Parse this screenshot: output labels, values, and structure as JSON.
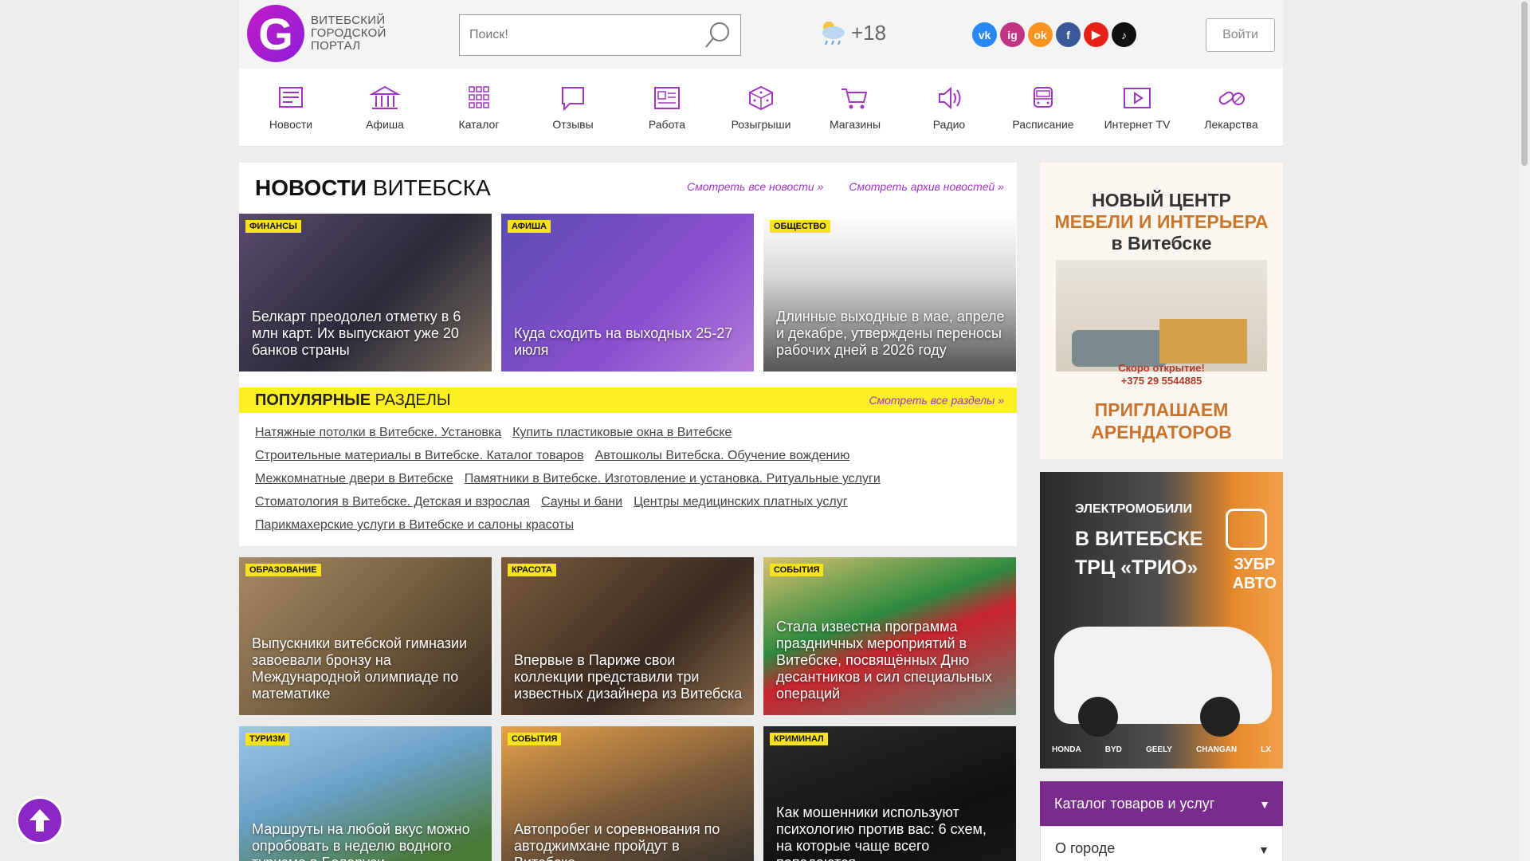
{
  "header": {
    "logo_letter": "G",
    "logo_lines": [
      "ВИТЕБСКИЙ",
      "ГОРОДСКОЙ",
      "ПОРТАЛ"
    ],
    "search_placeholder": "Поиск!",
    "weather_temp": "+18",
    "login_label": "Войти",
    "socials": [
      {
        "name": "vk-icon",
        "label": "vk",
        "color": "#2787f5"
      },
      {
        "name": "instagram-icon",
        "label": "ig",
        "color": "#c13584"
      },
      {
        "name": "odnoklassniki-icon",
        "label": "ok",
        "color": "#f7931e"
      },
      {
        "name": "facebook-icon",
        "label": "f",
        "color": "#3b5998"
      },
      {
        "name": "youtube-icon",
        "label": "▶",
        "color": "#e62117"
      },
      {
        "name": "tiktok-icon",
        "label": "♪",
        "color": "#111111"
      }
    ]
  },
  "nav": [
    {
      "label": "Новости",
      "icon": "newspaper-icon"
    },
    {
      "label": "Афиша",
      "icon": "theater-icon"
    },
    {
      "label": "Каталог",
      "icon": "grid-icon"
    },
    {
      "label": "Отзывы",
      "icon": "chat-icon"
    },
    {
      "label": "Работа",
      "icon": "resume-icon"
    },
    {
      "label": "Розыгрыши",
      "icon": "dice-icon"
    },
    {
      "label": "Магазины",
      "icon": "cart-icon"
    },
    {
      "label": "Радио",
      "icon": "speaker-icon"
    },
    {
      "label": "Расписание",
      "icon": "bus-icon"
    },
    {
      "label": "Интернет TV",
      "icon": "play-icon"
    },
    {
      "label": "Лекарства",
      "icon": "pill-icon"
    }
  ],
  "news": {
    "title_bold": "НОВОСТИ",
    "title_rest": "ВИТЕБСКА",
    "link_all": "Смотреть все новости »",
    "link_archive": "Смотреть архив новостей »",
    "top_cards": [
      {
        "tag": "ФИНАНСЫ",
        "title": "Белкарт преодолел отметку в 6 млн карт. Их выпускают уже 20 банков страны",
        "bg": "linear-gradient(135deg,#5a4a6e,#2b2b3a 55%,#7a6a5a)"
      },
      {
        "tag": "АФИША",
        "title": "Куда сходить на выходных 25-27 июля",
        "bg": "linear-gradient(135deg,#5b4bb3,#8a4fcf 60%,#b57ad9)"
      },
      {
        "tag": "ОБЩЕСТВО",
        "title": "Длинные выходные в мае, апреле и декабре, утверждены переносы рабочих дней в 2026 году",
        "bg": "linear-gradient(180deg,#ffffff,#d8d8d8 40%,#555 100%)"
      }
    ],
    "cards_row2": [
      {
        "tag": "ОБРАЗОВАНИЕ",
        "title": "Выпускники витебской гимназии завоевали бронзу на Международной олимпиаде по математике",
        "bg": "linear-gradient(135deg,#a88a64,#6b5538 60%,#3c2f22)"
      },
      {
        "tag": "КРАСОТА",
        "title": "Впервые в Париже свои коллекции представили три известных дизайнера из Витебска",
        "bg": "linear-gradient(135deg,#7a5a3c,#3a2a20 60%,#8a6a4a)"
      },
      {
        "tag": "СОБЫТИЯ",
        "title": "Стала известна программа праздничных мероприятий в Витебске, посвящённых Дню десантников и сил специальных операций",
        "bg": "linear-gradient(160deg,#d8c070,#2d8a3e 40%,#c8242c 55%,#6a7a6a)"
      }
    ],
    "cards_row3": [
      {
        "tag": "ТУРИЗМ",
        "title": "Маршруты на любой вкус можно опробовать в неделю водного туризма в Беларуси",
        "bg": "linear-gradient(160deg,#9ec7e8,#6aa0c4 40%,#4a7a3a 80%)"
      },
      {
        "tag": "СОБЫТИЯ",
        "title": "Автопробег и соревнования по автоджимхане пройдут в Витебске",
        "bg": "linear-gradient(160deg,#e6a24a,#7a5a3a 50%,#2a2a2a)"
      },
      {
        "tag": "КРИМИНАЛ",
        "title": "Как мошенники используют психологию против вас: 6 схем, на которые чаще всего попадаются",
        "bg": "linear-gradient(160deg,#2a2a2a,#111 60%,#1a1a1a)"
      }
    ]
  },
  "popular": {
    "title_bold": "ПОПУЛЯРНЫЕ",
    "title_rest": "РАЗДЕЛЫ",
    "link_all": "Смотреть все разделы »",
    "lines": [
      [
        "Натяжные потолки в Витебске. Установка",
        "Купить пластиковые окна в Витебске"
      ],
      [
        "Строительные материалы в Витебске. Каталог товаров",
        "Автошколы Витебска. Обучение вождению"
      ],
      [
        "Межкомнатные двери в Витебске",
        "Памятники в Витебске. Изготовление и установка. Ритуальные услуги"
      ],
      [
        "Стоматология в Витебске. Детская и взрослая",
        "Сауны и бани",
        "Центры медицинских платных услуг"
      ],
      [
        "Парикмахерские услуги в Витебске и салоны красоты"
      ]
    ]
  },
  "side": {
    "banner1": {
      "line1": "НОВЫЙ ЦЕНТР",
      "line2": "МЕБЕЛИ И ИНТЕРЬЕРА",
      "line3": "в Витебске",
      "soon": "Скоро открытие!",
      "phone": "+375 29 5544885",
      "invite1": "ПРИГЛАШАЕМ",
      "invite2": "АРЕНДАТОРОВ"
    },
    "banner2": {
      "line1": "ЭЛЕКТРОМОБИЛИ",
      "line2": "В ВИТЕБСКЕ",
      "line3": "ТРЦ «ТРИО»",
      "brand1": "ЗУБР",
      "brand2": "АВТО",
      "brands": [
        "HONDA",
        "BYD",
        "GEELY",
        "CHANGAN",
        "LX"
      ]
    },
    "accordion_open": "Каталог товаров и услуг",
    "accordion_closed": "О городе"
  }
}
